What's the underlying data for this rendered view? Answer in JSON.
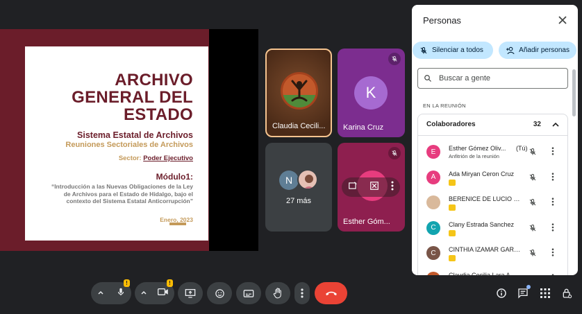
{
  "slide": {
    "title_line1": "ARCHIVO",
    "title_line2": "GENERAL DEL",
    "title_line3": "ESTADO",
    "subtitle1": "Sistema Estatal de Archivos",
    "subtitle2": "Reuniones Sectoriales de Archivos",
    "sector_label": "Sector: ",
    "sector_value": "Poder Ejecutivo",
    "module": "Módulo1:",
    "description": "“Introducción a las Nuevas Obligaciones de la Ley de Archivos para el Estado de Hidalgo, bajo el contexto del Sistema Estatal Anticorrupción”",
    "date": "Enero, 2023",
    "colors": {
      "maroon": "#6b1d2a",
      "gold": "#c49a5a"
    }
  },
  "tiles": {
    "claudia": {
      "name": "Claudia Cecili..."
    },
    "karina": {
      "name": "Karina Cruz",
      "initial": "K"
    },
    "more": {
      "initial": "N",
      "label": "27 más"
    },
    "esther": {
      "name": "Esther Góm..."
    }
  },
  "panel": {
    "title": "Personas",
    "mute_all": "Silenciar a todos",
    "add_people": "Añadir personas",
    "search_placeholder": "Buscar a gente",
    "section": "EN LA REUNIÓN",
    "group_label": "Colaboradores",
    "group_count": "32",
    "participants": [
      {
        "initial": "E",
        "color": "#e73c7e",
        "name": "Esther Gómez Oliv...",
        "you": "(Tú)",
        "sub": "Anfitrión de la reunión"
      },
      {
        "initial": "A",
        "color": "#e73c7e",
        "name": "Ada Miryan Ceron Cruz"
      },
      {
        "initial": "",
        "color": "#d9b99b",
        "name": "BERENICE DE LUCIO ES..."
      },
      {
        "initial": "C",
        "color": "#12a4af",
        "name": "Clany Estrada Sanchez"
      },
      {
        "initial": "C",
        "color": "#795548",
        "name": "CINTHIA IZAMAR GARC..."
      },
      {
        "initial": "",
        "color": "#c2592b",
        "name": "Claudia Cecilia Lara A..."
      }
    ]
  }
}
